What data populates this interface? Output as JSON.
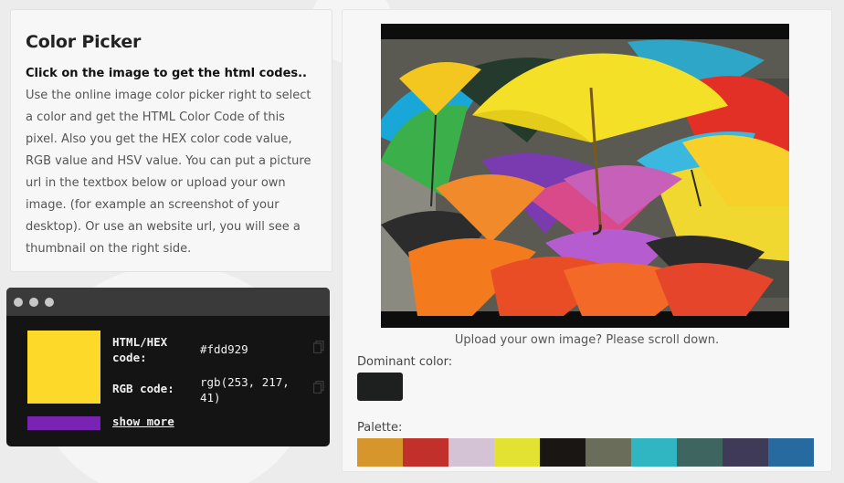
{
  "info": {
    "title": "Color Picker",
    "lead": "Click on the image to get the html codes..",
    "body": "Use the online image color picker right to select a color and get the HTML Color Code of this pixel. Also you get the HEX color code value, RGB value and HSV value. You can put a picture url in the textbox below or upload your own image. (for example an screenshot of your desktop). Or use an website url, you will see a thumbnail on the right side."
  },
  "picker": {
    "selected_color": "#fdd929",
    "accent_color": "#7a22b4",
    "hex_label": "HTML/HEX\ncode:",
    "hex_value": "#fdd929",
    "rgb_label": "RGB code:",
    "rgb_value": "rgb(253, 217,\n41)",
    "show_more": "show more",
    "copy_icon": "copy-icon"
  },
  "image_panel": {
    "caption": "Upload your own image? Please scroll down.",
    "dominant_label": "Dominant color:",
    "dominant_color": "#1e2020",
    "palette_label": "Palette:",
    "palette": [
      "#d6962c",
      "#c1302a",
      "#d4c3d4",
      "#e3e131",
      "#1a1614",
      "#6b6d5b",
      "#2fb6c2",
      "#3f6560",
      "#3e3a57",
      "#266aa0"
    ]
  }
}
